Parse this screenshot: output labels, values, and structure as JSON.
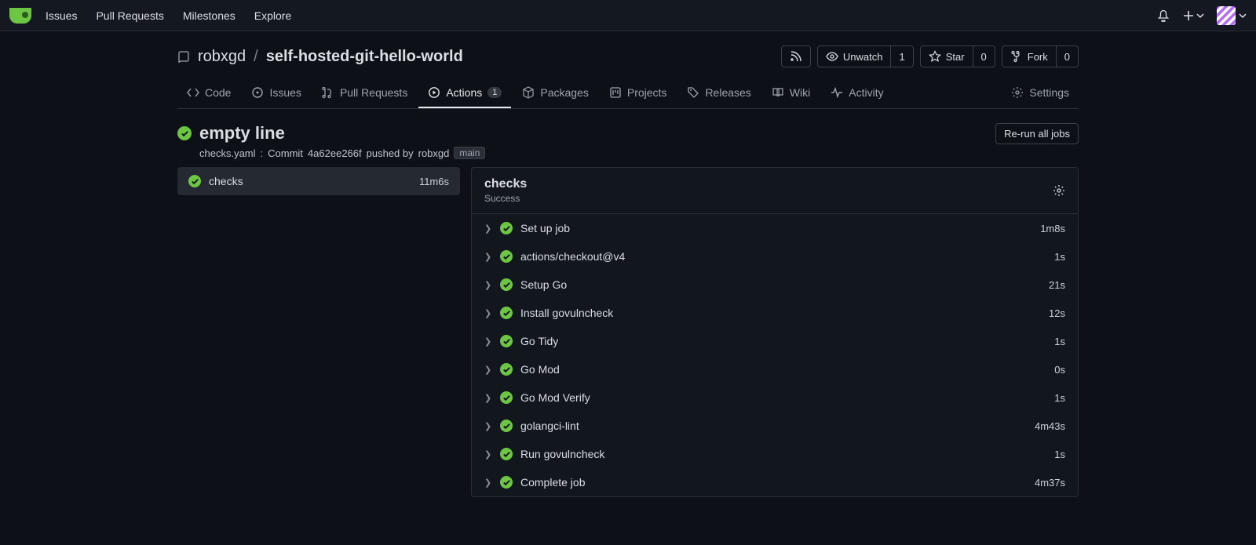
{
  "nav": {
    "items": [
      "Issues",
      "Pull Requests",
      "Milestones",
      "Explore"
    ]
  },
  "repo": {
    "owner": "robxgd",
    "name": "self-hosted-git-hello-world",
    "actions": {
      "unwatch": {
        "label": "Unwatch",
        "count": "1"
      },
      "star": {
        "label": "Star",
        "count": "0"
      },
      "fork": {
        "label": "Fork",
        "count": "0"
      }
    }
  },
  "tabs": [
    {
      "label": "Code",
      "icon": "code"
    },
    {
      "label": "Issues",
      "icon": "issue"
    },
    {
      "label": "Pull Requests",
      "icon": "pr"
    },
    {
      "label": "Actions",
      "icon": "play",
      "count": "1",
      "active": true
    },
    {
      "label": "Packages",
      "icon": "package"
    },
    {
      "label": "Projects",
      "icon": "project"
    },
    {
      "label": "Releases",
      "icon": "tag"
    },
    {
      "label": "Wiki",
      "icon": "book"
    },
    {
      "label": "Activity",
      "icon": "pulse"
    }
  ],
  "settings_tab": "Settings",
  "run": {
    "title": "empty line",
    "workflow_file": "checks.yaml",
    "commit_text": "Commit",
    "commit_hash": "4a62ee266f",
    "pushed_by_text": "pushed by",
    "user": "robxgd",
    "branch": "main",
    "rerun_label": "Re-run all jobs"
  },
  "job": {
    "name": "checks",
    "status": "Success",
    "duration": "11m6s"
  },
  "steps": [
    {
      "name": "Set up job",
      "duration": "1m8s"
    },
    {
      "name": "actions/checkout@v4",
      "duration": "1s"
    },
    {
      "name": "Setup Go",
      "duration": "21s"
    },
    {
      "name": "Install govulncheck",
      "duration": "12s"
    },
    {
      "name": "Go Tidy",
      "duration": "1s"
    },
    {
      "name": "Go Mod",
      "duration": "0s"
    },
    {
      "name": "Go Mod Verify",
      "duration": "1s"
    },
    {
      "name": "golangci-lint",
      "duration": "4m43s"
    },
    {
      "name": "Run govulncheck",
      "duration": "1s"
    },
    {
      "name": "Complete job",
      "duration": "4m37s"
    }
  ]
}
